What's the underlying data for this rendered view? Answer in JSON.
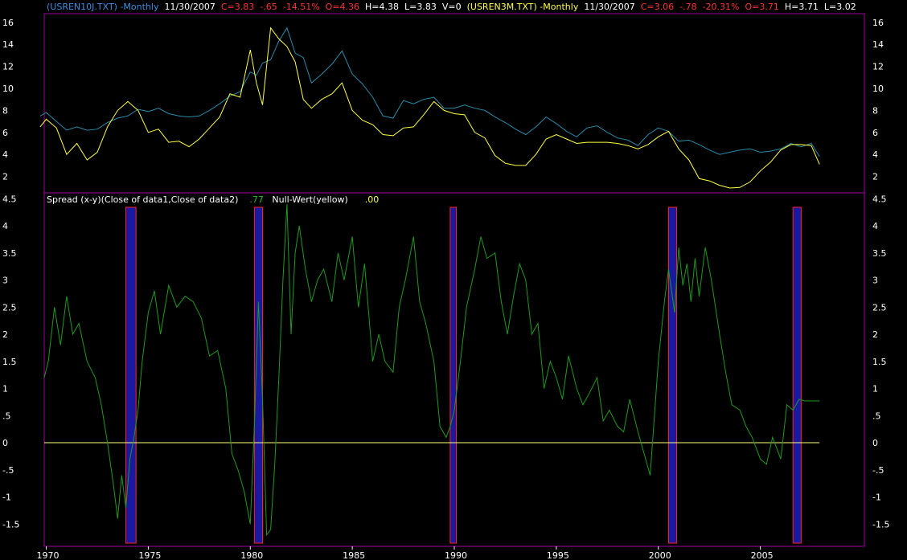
{
  "colors": {
    "background": "#000000",
    "frame": "#a000a0",
    "axis_text": "#ffffff",
    "yield10y": "#2a8aa8",
    "yield3m": "#ffff40",
    "spread": "#1e9a1e",
    "null_line": "#ffff80",
    "recession_fill": "#1a1aa0",
    "recession_stroke": "#ff2020",
    "hdr_blue": "#3a8fe0",
    "hdr_red": "#ff3030",
    "hdr_white": "#ffffff",
    "hdr_yellow": "#ffff40",
    "hdr_green": "#20c020"
  },
  "top_header": {
    "s1_name": "(USREN10J.TXT) -Monthly",
    "s1_date": "11/30/2007",
    "s1_close": "C=3.83",
    "s1_change": "-.65",
    "s1_pct": "-14.51%",
    "s1_open": "O=4.36",
    "s1_high": "H=4.38",
    "s1_low": "L=3.83",
    "s1_vol": "V=0",
    "s2_name": "(USREN3M.TXT) -Monthly",
    "s2_date": "11/30/2007",
    "s2_close": "C=3.06",
    "s2_change": "-.78",
    "s2_pct": "-20.31%",
    "s2_open": "O=3.71",
    "s2_high": "H=3.71",
    "s2_low": "L=3.02"
  },
  "bottom_header": {
    "spread_label": "Spread (x-y)(Close of data1,Close of data2)",
    "spread_value": ".77",
    "null_label": "Null-Wert(yellow)",
    "null_value": ".00"
  },
  "chart_data": [
    {
      "type": "line",
      "ylim": [
        1,
        16.8
      ],
      "y_ticks": [
        "2",
        "4",
        "6",
        "8",
        "10",
        "12",
        "14",
        "16"
      ],
      "series": [
        {
          "name": "(USREN10J.TXT) -Monthly",
          "x": [
            1969.7,
            1970.0,
            1970.5,
            1971.0,
            1971.5,
            1972.0,
            1972.5,
            1973.0,
            1973.5,
            1974.0,
            1974.5,
            1975.0,
            1975.5,
            1976.0,
            1976.5,
            1977.0,
            1977.5,
            1978.0,
            1978.5,
            1979.0,
            1979.5,
            1980.0,
            1980.3,
            1980.6,
            1981.0,
            1981.4,
            1981.8,
            1982.2,
            1982.6,
            1983.0,
            1983.5,
            1984.0,
            1984.5,
            1985.0,
            1985.5,
            1986.0,
            1986.5,
            1987.0,
            1987.5,
            1988.0,
            1988.5,
            1989.0,
            1989.5,
            1990.0,
            1990.5,
            1991.0,
            1991.5,
            1992.0,
            1992.5,
            1993.0,
            1993.5,
            1994.0,
            1994.5,
            1995.0,
            1995.5,
            1996.0,
            1996.5,
            1997.0,
            1997.5,
            1998.0,
            1998.5,
            1999.0,
            1999.5,
            2000.0,
            2000.5,
            2001.0,
            2001.5,
            2002.0,
            2002.5,
            2003.0,
            2003.5,
            2004.0,
            2004.5,
            2005.0,
            2005.5,
            2006.0,
            2006.5,
            2007.0,
            2007.5,
            2007.9
          ],
          "values": [
            7.5,
            7.8,
            7.0,
            6.2,
            6.5,
            6.2,
            6.3,
            6.9,
            7.3,
            7.5,
            8.1,
            7.9,
            8.2,
            7.7,
            7.5,
            7.4,
            7.5,
            8.0,
            8.6,
            9.3,
            9.7,
            11.5,
            11.2,
            12.3,
            12.6,
            14.3,
            15.5,
            13.2,
            12.8,
            10.5,
            11.3,
            12.2,
            13.4,
            11.3,
            10.4,
            9.2,
            7.5,
            7.3,
            8.9,
            8.6,
            9.0,
            9.2,
            8.2,
            8.2,
            8.5,
            8.2,
            8.0,
            7.4,
            6.9,
            6.3,
            5.8,
            6.5,
            7.4,
            6.8,
            6.1,
            5.6,
            6.4,
            6.6,
            6.0,
            5.5,
            5.3,
            4.8,
            5.8,
            6.4,
            6.1,
            5.2,
            5.3,
            4.9,
            4.4,
            4.0,
            4.2,
            4.4,
            4.5,
            4.2,
            4.3,
            4.5,
            5.0,
            4.7,
            5.0,
            3.8
          ]
        },
        {
          "name": "(USREN3M.TXT) -Monthly",
          "x": [
            1969.7,
            1970.0,
            1970.5,
            1971.0,
            1971.5,
            1972.0,
            1972.5,
            1973.0,
            1973.5,
            1974.0,
            1974.5,
            1975.0,
            1975.5,
            1976.0,
            1976.5,
            1977.0,
            1977.5,
            1978.0,
            1978.5,
            1979.0,
            1979.5,
            1980.0,
            1980.3,
            1980.6,
            1981.0,
            1981.4,
            1981.8,
            1982.2,
            1982.6,
            1983.0,
            1983.5,
            1984.0,
            1984.5,
            1985.0,
            1985.5,
            1986.0,
            1986.5,
            1987.0,
            1987.5,
            1988.0,
            1988.5,
            1989.0,
            1989.5,
            1990.0,
            1990.5,
            1991.0,
            1991.5,
            1992.0,
            1992.5,
            1993.0,
            1993.5,
            1994.0,
            1994.5,
            1995.0,
            1995.5,
            1996.0,
            1996.5,
            1997.0,
            1997.5,
            1998.0,
            1998.5,
            1999.0,
            1999.5,
            2000.0,
            2000.5,
            2001.0,
            2001.5,
            2002.0,
            2002.5,
            2003.0,
            2003.5,
            2004.0,
            2004.5,
            2005.0,
            2005.5,
            2006.0,
            2006.5,
            2007.0,
            2007.5,
            2007.9
          ],
          "values": [
            6.5,
            7.2,
            6.4,
            4.0,
            5.0,
            3.5,
            4.2,
            6.5,
            8.0,
            8.8,
            8.0,
            6.0,
            6.3,
            5.1,
            5.2,
            4.7,
            5.4,
            6.4,
            7.4,
            9.5,
            9.2,
            13.5,
            10.5,
            8.5,
            15.5,
            14.5,
            13.8,
            12.4,
            9.0,
            8.2,
            9.0,
            9.5,
            10.5,
            8.0,
            7.1,
            6.7,
            5.8,
            5.7,
            6.4,
            6.5,
            7.6,
            8.8,
            8.0,
            7.7,
            7.6,
            6.0,
            5.5,
            3.9,
            3.2,
            3.0,
            3.0,
            4.0,
            5.4,
            5.8,
            5.4,
            5.0,
            5.1,
            5.1,
            5.1,
            5.0,
            4.8,
            4.5,
            4.9,
            5.6,
            6.1,
            4.5,
            3.5,
            1.8,
            1.6,
            1.2,
            0.95,
            1.0,
            1.5,
            2.5,
            3.3,
            4.4,
            4.9,
            4.9,
            4.8,
            3.1
          ]
        }
      ]
    },
    {
      "type": "line",
      "ylim": [
        -1.75,
        4.55
      ],
      "y_ticks": [
        "4.5",
        "4",
        "3.5",
        "3",
        "2.5",
        "2",
        "1.5",
        "1",
        ".5",
        "0",
        "-.5",
        "-1",
        "-1.5"
      ],
      "x_ticks": [
        "1970",
        "1975",
        "1980",
        "1985",
        "1990",
        "1995",
        "2000",
        "2005"
      ],
      "x_tick_values": [
        1970,
        1975,
        1980,
        1985,
        1990,
        1995,
        2000,
        2005
      ],
      "xlim": [
        1969.9,
        2010.1
      ],
      "recessions": [
        [
          1973.9,
          1974.4
        ],
        [
          1980.2,
          1980.6
        ],
        [
          1989.8,
          1990.1
        ],
        [
          2000.5,
          2000.9
        ],
        [
          2006.6,
          2007.0
        ]
      ],
      "series": [
        {
          "name": "Spread (x-y)(Close of data1,Close of data2)",
          "x": [
            1969.9,
            1970.1,
            1970.4,
            1970.7,
            1971.0,
            1971.3,
            1971.6,
            1972.0,
            1972.4,
            1972.7,
            1973.0,
            1973.3,
            1973.5,
            1973.7,
            1973.9,
            1974.1,
            1974.3,
            1974.5,
            1974.7,
            1975.0,
            1975.3,
            1975.6,
            1976.0,
            1976.4,
            1976.8,
            1977.2,
            1977.6,
            1978.0,
            1978.4,
            1978.8,
            1979.1,
            1979.4,
            1979.7,
            1980.0,
            1980.2,
            1980.4,
            1980.6,
            1980.8,
            1981.0,
            1981.2,
            1981.4,
            1981.6,
            1981.8,
            1982.0,
            1982.2,
            1982.4,
            1982.7,
            1983.0,
            1983.3,
            1983.6,
            1984.0,
            1984.3,
            1984.6,
            1985.0,
            1985.3,
            1985.6,
            1986.0,
            1986.3,
            1986.6,
            1987.0,
            1987.3,
            1987.6,
            1988.0,
            1988.3,
            1988.6,
            1989.0,
            1989.3,
            1989.6,
            1989.8,
            1990.0,
            1990.3,
            1990.6,
            1991.0,
            1991.3,
            1991.6,
            1992.0,
            1992.3,
            1992.6,
            1992.9,
            1993.2,
            1993.5,
            1993.8,
            1994.1,
            1994.4,
            1994.7,
            1995.0,
            1995.3,
            1995.6,
            1996.0,
            1996.3,
            1996.6,
            1997.0,
            1997.3,
            1997.6,
            1998.0,
            1998.3,
            1998.6,
            1999.0,
            1999.3,
            1999.6,
            2000.0,
            2000.3,
            2000.5,
            2000.8,
            2001.0,
            2001.2,
            2001.4,
            2001.6,
            2001.8,
            2002.0,
            2002.3,
            2002.6,
            2003.0,
            2003.3,
            2003.6,
            2004.0,
            2004.3,
            2004.6,
            2005.0,
            2005.3,
            2005.6,
            2006.0,
            2006.3,
            2006.6,
            2006.9,
            2007.2,
            2007.5,
            2007.9
          ],
          "values": [
            1.2,
            1.5,
            2.5,
            1.8,
            2.7,
            2.0,
            2.2,
            1.5,
            1.2,
            0.7,
            0.0,
            -0.8,
            -1.4,
            -0.6,
            -1.2,
            -0.3,
            0.1,
            0.6,
            1.5,
            2.4,
            2.8,
            2.0,
            2.9,
            2.5,
            2.7,
            2.6,
            2.3,
            1.6,
            1.7,
            1.0,
            -0.2,
            -0.5,
            -0.9,
            -1.5,
            0.3,
            2.6,
            0.8,
            -1.7,
            -1.6,
            -0.4,
            1.2,
            3.0,
            4.4,
            2.0,
            3.5,
            4.0,
            3.2,
            2.6,
            3.0,
            3.2,
            2.6,
            3.5,
            3.0,
            3.8,
            2.5,
            3.3,
            1.5,
            2.0,
            1.5,
            1.3,
            2.5,
            3.0,
            3.8,
            2.6,
            2.2,
            1.5,
            0.3,
            0.1,
            0.3,
            0.6,
            1.5,
            2.5,
            3.2,
            3.8,
            3.4,
            3.5,
            2.6,
            2.0,
            2.7,
            3.3,
            3.0,
            2.0,
            2.2,
            1.0,
            1.5,
            1.2,
            0.8,
            1.6,
            1.0,
            0.7,
            0.9,
            1.2,
            0.4,
            0.6,
            0.3,
            0.2,
            0.8,
            0.2,
            -0.2,
            -0.6,
            1.5,
            2.6,
            3.2,
            2.4,
            3.6,
            2.9,
            3.3,
            2.6,
            3.4,
            2.7,
            3.6,
            3.0,
            2.0,
            1.3,
            0.7,
            0.6,
            0.3,
            0.1,
            -0.3,
            -0.4,
            0.1,
            -0.3,
            0.7,
            0.6,
            0.8,
            0.77,
            0.77,
            0.77
          ]
        },
        {
          "name": "Null-Wert(yellow)",
          "x": [
            1969.9,
            2007.9
          ],
          "values": [
            0,
            0
          ]
        }
      ]
    }
  ]
}
